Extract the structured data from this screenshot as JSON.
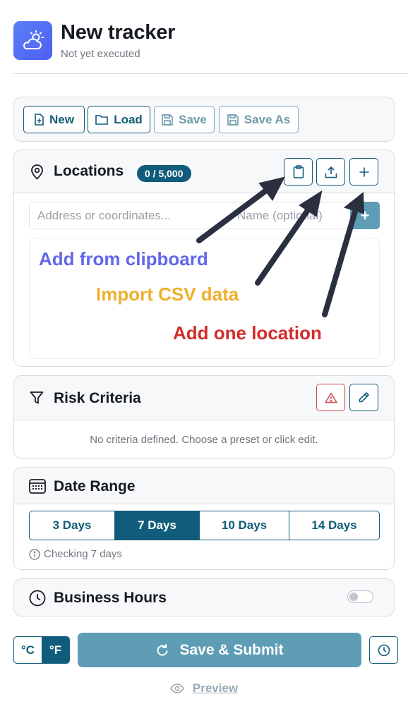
{
  "header": {
    "title": "New tracker",
    "subtitle": "Not yet executed",
    "icon": "weather-icon"
  },
  "toolbar": {
    "new_label": "New",
    "load_label": "Load",
    "save_label": "Save",
    "save_as_label": "Save As"
  },
  "locations": {
    "title": "Locations",
    "badge": "0 / 5,000",
    "address_placeholder": "Address or coordinates...",
    "name_placeholder": "Name (optional)",
    "add_button_label": "+",
    "annotations": {
      "clipboard": "Add from clipboard",
      "csv": "Import CSV data",
      "one": "Add one location"
    },
    "annotation_colors": {
      "clipboard": "#6267e8",
      "csv": "#efb02e",
      "one": "#d22b2b"
    }
  },
  "risk": {
    "title": "Risk Criteria",
    "empty_text": "No criteria defined. Choose a preset or click edit."
  },
  "date_range": {
    "title": "Date Range",
    "options": [
      "3 Days",
      "7 Days",
      "10 Days",
      "14 Days"
    ],
    "selected": "7 Days",
    "hint": "Checking 7 days"
  },
  "business_hours": {
    "title": "Business Hours",
    "enabled": false
  },
  "footer": {
    "unit_c": "°C",
    "unit_f": "°F",
    "selected_unit": "°F",
    "submit_label": "Save & Submit",
    "preview_label": "Preview"
  },
  "colors": {
    "primary": "#105c7a",
    "primary_muted": "#5e9db5",
    "danger": "#d24a4a",
    "app_icon": "#5164f3"
  }
}
